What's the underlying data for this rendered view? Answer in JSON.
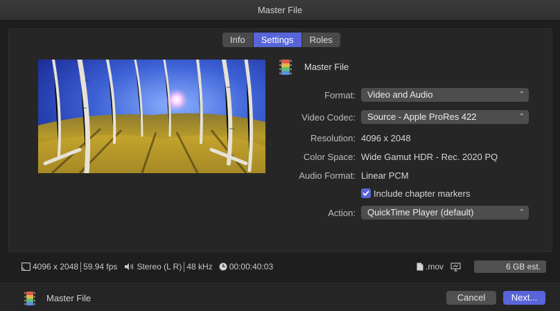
{
  "window": {
    "title": "Master File"
  },
  "tabs": [
    {
      "label": "Info",
      "active": false
    },
    {
      "label": "Settings",
      "active": true
    },
    {
      "label": "Roles",
      "active": false
    }
  ],
  "file": {
    "name": "Master File",
    "icon": "film-strip-icon"
  },
  "settings": {
    "format": {
      "label": "Format:",
      "value": "Video and Audio"
    },
    "video_codec": {
      "label": "Video Codec:",
      "value": "Source - Apple ProRes 422"
    },
    "resolution": {
      "label": "Resolution:",
      "value": "4096 x 2048"
    },
    "color_space": {
      "label": "Color Space:",
      "value": "Wide Gamut HDR - Rec. 2020 PQ"
    },
    "audio_format": {
      "label": "Audio Format:",
      "value": "Linear PCM"
    },
    "chapter_markers": {
      "label": "Include chapter markers",
      "checked": true
    },
    "action": {
      "label": "Action:",
      "value": "QuickTime Player (default)"
    }
  },
  "status": {
    "resolution": "4096 x 2048",
    "fps": "59.94 fps",
    "audio_channels": "Stereo (L R)",
    "sample_rate": "48 kHz",
    "duration": "00:00:40:03",
    "extension": ".mov",
    "size_estimate": "6 GB est."
  },
  "footer": {
    "name": "Master File",
    "cancel_label": "Cancel",
    "next_label": "Next..."
  },
  "colors": {
    "accent": "#5865d8",
    "background": "#1e1e1e",
    "control": "#4d4d4d"
  }
}
